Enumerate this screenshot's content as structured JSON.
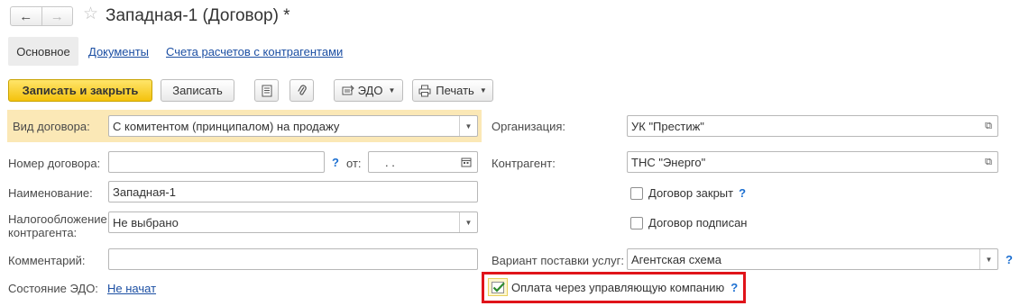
{
  "window": {
    "title": "Западная-1 (Договор) *",
    "nav_back_icon": "←",
    "nav_forward_icon": "→",
    "favorite_icon": "☆"
  },
  "tabs": [
    {
      "label": "Основное",
      "active": true
    },
    {
      "label": "Документы",
      "active": false
    },
    {
      "label": "Счета расчетов с контрагентами",
      "active": false
    }
  ],
  "toolbar": {
    "save_close_label": "Записать и закрыть",
    "save_label": "Записать",
    "edo_label": "ЭДО",
    "print_label": "Печать"
  },
  "left": {
    "contract_type": {
      "label": "Вид договора:",
      "value": "С комитентом (принципалом) на продажу"
    },
    "contract_number": {
      "label": "Номер договора:",
      "value": "",
      "help": "?",
      "date_label": "от:",
      "date_value": ".   ."
    },
    "name": {
      "label": "Наименование:",
      "value": "Западная-1"
    },
    "taxation": {
      "label_line1": "Налогообложение",
      "label_line2": "контрагента:",
      "value": "Не выбрано"
    },
    "comment": {
      "label": "Комментарий:",
      "value": ""
    },
    "edo_state": {
      "label": "Состояние ЭДО:",
      "value": "Не начат"
    }
  },
  "right": {
    "organization": {
      "label": "Организация:",
      "value": "УК \"Престиж\""
    },
    "counterparty": {
      "label": "Контрагент:",
      "value": "ТНС \"Энерго\""
    },
    "contract_closed": {
      "label": "Договор закрыт",
      "checked": false,
      "help": "?"
    },
    "contract_signed": {
      "label": "Договор подписан",
      "checked": false
    },
    "service_variant": {
      "label": "Вариант поставки услуг:",
      "value": "Агентская схема",
      "help": "?"
    },
    "payment_via_mc": {
      "label": "Оплата через управляющую компанию",
      "checked": true,
      "help": "?"
    }
  },
  "colors": {
    "accent_button": "#f4c20d",
    "highlight_row": "#fbe8b6",
    "red_box": "#e0141a",
    "link": "#1c4fa3",
    "help": "#1c6fd1",
    "check": "#2e8b2e"
  }
}
